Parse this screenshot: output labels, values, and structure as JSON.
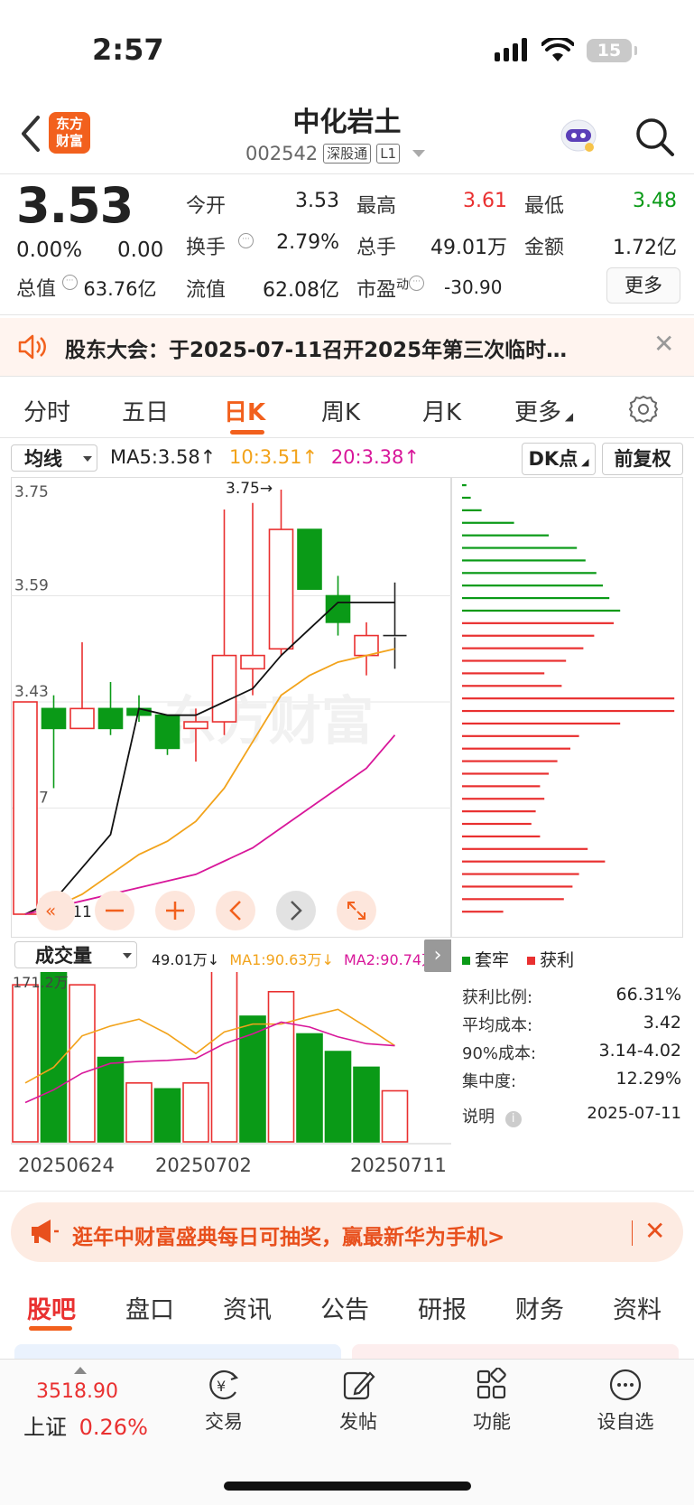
{
  "status_bar": {
    "time": "2:57",
    "battery": "15"
  },
  "header": {
    "logo_line1": "东方",
    "logo_line2": "财富",
    "stock_name": "中化岩土",
    "stock_code": "002542",
    "market_tag": "深股通",
    "level_tag": "L1"
  },
  "quote": {
    "price": "3.53",
    "change_pct": "0.00%",
    "change_amt": "0.00",
    "total_value_label": "总值",
    "total_value": "63.76亿",
    "open_label": "今开",
    "open": "3.53",
    "high_label": "最高",
    "high": "3.61",
    "low_label": "最低",
    "low": "3.48",
    "turnover_label": "换手",
    "turnover": "2.79%",
    "volume_label": "总手",
    "volume": "49.01万",
    "amount_label": "金额",
    "amount": "1.72亿",
    "float_label": "流值",
    "float_value": "62.08亿",
    "pe_label": "市盈",
    "pe_sup": "动",
    "pe": "-30.90",
    "more_label": "更多"
  },
  "announcement": {
    "text": "股东大会：于2025-07-11召开2025年第三次临时…"
  },
  "period_tabs": [
    "分时",
    "五日",
    "日K",
    "周K",
    "月K",
    "更多"
  ],
  "chart_controls": {
    "ma_select": "均线",
    "ma5": "MA5:3.58↑",
    "ma10": "10:3.51↑",
    "ma20": "20:3.38↑",
    "dk_label": "DK点",
    "adjust_label": "前复权",
    "marker_high": "3.75→",
    "marker_low": "3.11",
    "watermark": "东方财富"
  },
  "chart_data": [
    {
      "type": "candlestick",
      "y_ticks": [
        "3.75",
        "3.59",
        "3.43",
        "3.27",
        "3.11"
      ],
      "ylim": [
        3.11,
        3.75
      ],
      "candles": [
        {
          "open": 3.11,
          "close": 3.43,
          "high": 3.43,
          "low": 3.11,
          "up": true
        },
        {
          "open": 3.42,
          "close": 3.39,
          "high": 3.44,
          "low": 3.3,
          "up": false
        },
        {
          "open": 3.39,
          "close": 3.42,
          "high": 3.52,
          "low": 3.39,
          "up": true
        },
        {
          "open": 3.42,
          "close": 3.39,
          "high": 3.46,
          "low": 3.38,
          "up": false
        },
        {
          "open": 3.42,
          "close": 3.41,
          "high": 3.44,
          "low": 3.4,
          "up": false
        },
        {
          "open": 3.41,
          "close": 3.36,
          "high": 3.41,
          "low": 3.35,
          "up": false
        },
        {
          "open": 3.39,
          "close": 3.4,
          "high": 3.42,
          "low": 3.34,
          "up": true
        },
        {
          "open": 3.4,
          "close": 3.5,
          "high": 3.72,
          "low": 3.38,
          "up": true
        },
        {
          "open": 3.48,
          "close": 3.5,
          "high": 3.73,
          "low": 3.44,
          "up": true
        },
        {
          "open": 3.51,
          "close": 3.69,
          "high": 3.75,
          "low": 3.5,
          "up": true
        },
        {
          "open": 3.69,
          "close": 3.6,
          "high": 3.69,
          "low": 3.6,
          "up": false
        },
        {
          "open": 3.59,
          "close": 3.55,
          "high": 3.62,
          "low": 3.53,
          "up": false
        },
        {
          "open": 3.5,
          "close": 3.53,
          "high": 3.55,
          "low": 3.47,
          "up": true
        },
        {
          "open": 3.53,
          "close": 3.53,
          "high": 3.61,
          "low": 3.48,
          "up": false
        }
      ],
      "ma5": [
        3.11,
        3.13,
        3.18,
        3.23,
        3.42,
        3.41,
        3.41,
        3.43,
        3.45,
        3.5,
        3.54,
        3.58,
        3.58,
        3.58
      ],
      "ma10": [
        3.11,
        3.12,
        3.14,
        3.17,
        3.2,
        3.22,
        3.25,
        3.3,
        3.37,
        3.44,
        3.47,
        3.49,
        3.5,
        3.51
      ],
      "ma20": [
        3.11,
        3.12,
        3.13,
        3.14,
        3.15,
        3.16,
        3.17,
        3.19,
        3.21,
        3.24,
        3.27,
        3.3,
        3.33,
        3.38
      ]
    },
    {
      "type": "bar",
      "name": "成交量",
      "y_max_label": "171.2万",
      "ylim": [
        0,
        171.2
      ],
      "values": [
        160,
        178,
        160,
        86,
        60,
        54,
        60,
        178,
        128,
        153,
        110,
        92,
        76,
        52
      ],
      "up": [
        true,
        false,
        true,
        false,
        true,
        false,
        true,
        true,
        false,
        true,
        false,
        false,
        false,
        true
      ],
      "ma1": [
        60,
        76,
        108,
        118,
        125,
        110,
        90,
        112,
        120,
        120,
        128,
        135,
        117,
        98
      ],
      "ma2": [
        40,
        53,
        70,
        80,
        82,
        83,
        85,
        100,
        110,
        122,
        117,
        107,
        100,
        98
      ],
      "x_labels": [
        "20250624",
        "20250702",
        "20250711"
      ]
    },
    {
      "type": "bar",
      "name": "筹码分布",
      "orientation": "horizontal",
      "values": [
        2,
        4,
        9,
        24,
        40,
        53,
        57,
        62,
        65,
        68,
        73,
        70,
        61,
        56,
        48,
        38,
        46,
        98,
        98,
        73,
        54,
        50,
        44,
        40,
        36,
        38,
        34,
        32,
        36,
        58,
        66,
        54,
        51,
        47,
        19
      ],
      "profit": [
        false,
        false,
        false,
        false,
        false,
        false,
        false,
        false,
        false,
        false,
        false,
        true,
        true,
        true,
        true,
        true,
        true,
        true,
        true,
        true,
        true,
        true,
        true,
        true,
        true,
        true,
        true,
        true,
        true,
        true,
        true,
        true,
        true,
        true,
        true
      ]
    }
  ],
  "volume": {
    "select_label": "成交量",
    "total": "49.01万↓",
    "ma1": "MA1:90.63万↓",
    "ma2": "MA2:90.74万↓"
  },
  "chip_stats": {
    "legend_hold": "套牢",
    "legend_profit": "获利",
    "profit_ratio_label": "获利比例:",
    "profit_ratio": "66.31%",
    "avg_cost_label": "平均成本:",
    "avg_cost": "3.42",
    "cost90_label": "90%成本:",
    "cost90": "3.14-4.02",
    "concentration_label": "集中度:",
    "concentration": "12.29%",
    "explain_label": "说明",
    "date": "2025-07-11"
  },
  "promo": {
    "text": "逛年中财富盛典每日可抽奖，赢最新华为手机>"
  },
  "bottom_tabs": [
    "股吧",
    "盘口",
    "资讯",
    "公告",
    "研报",
    "财务",
    "资料"
  ],
  "bottom_nav": {
    "index_price": "3518.90",
    "index_name": "上证",
    "index_pct": "0.26%",
    "items": [
      "交易",
      "发帖",
      "功能",
      "设自选"
    ]
  },
  "colors": {
    "up": "#e93030",
    "down": "#0a9a17",
    "brand": "#f2601d",
    "ma10": "#f2a31b",
    "ma20": "#d8179a"
  }
}
